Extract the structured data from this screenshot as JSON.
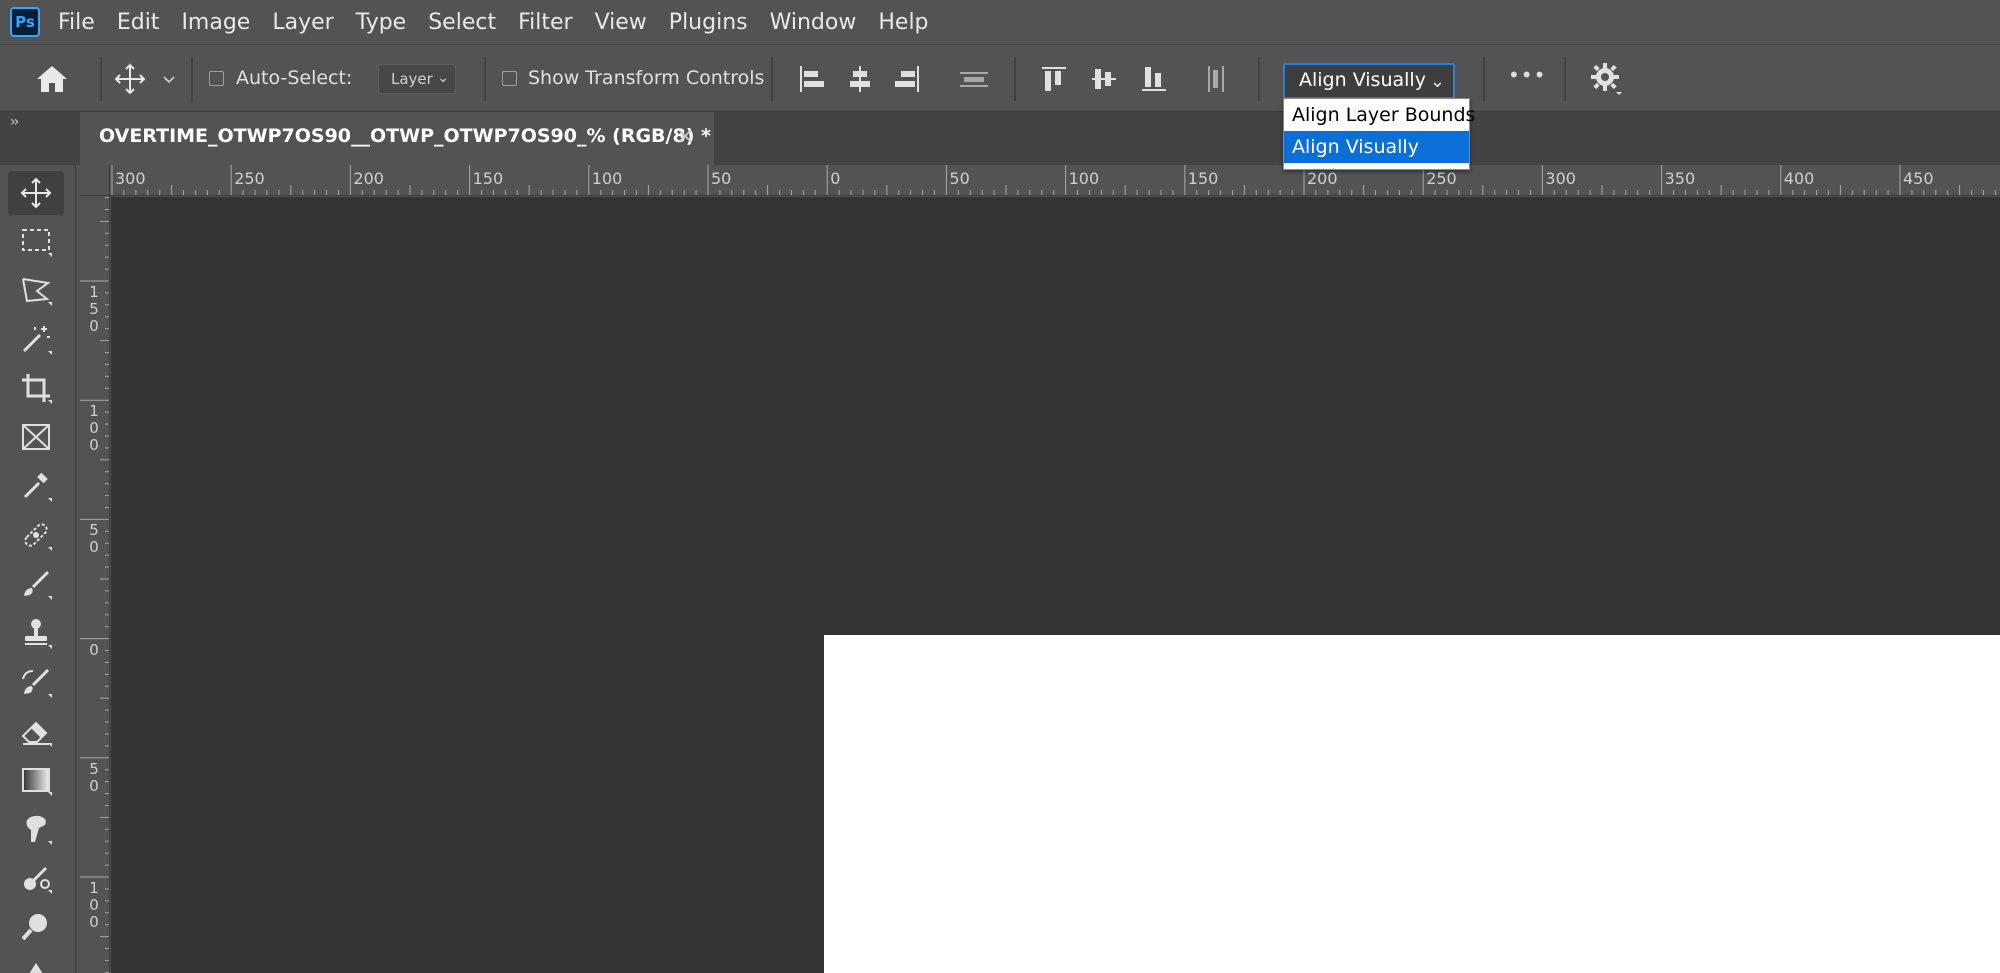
{
  "app": {
    "logo": "Ps"
  },
  "menu": [
    "File",
    "Edit",
    "Image",
    "Layer",
    "Type",
    "Select",
    "Filter",
    "View",
    "Plugins",
    "Window",
    "Help"
  ],
  "options": {
    "auto_select_label": "Auto-Select:",
    "auto_select_checked": false,
    "layer_select_value": "Layer",
    "show_transform_label": "Show Transform Controls",
    "show_transform_checked": false,
    "align_mode_value": "Align Visually",
    "more_label": "•••"
  },
  "align_dropdown": {
    "options": [
      "Align Layer Bounds",
      "Align Visually"
    ],
    "selected": "Align Visually"
  },
  "collapse_label": "››",
  "document_tab": {
    "title": "OVERTIME_OTWP7OS90__OTWP_OTWP7OS90_% (RGB/8) *",
    "close": "×"
  },
  "ruler_h_labels": [
    "300",
    "250",
    "200",
    "150",
    "100",
    "50",
    "0",
    "50",
    "100",
    "150",
    "200",
    "250",
    "300",
    "350",
    "400",
    "450"
  ],
  "ruler_v_labels": [
    "150",
    "100",
    "50",
    "0",
    "50",
    "100"
  ],
  "tools": [
    "move-tool",
    "marquee-tool",
    "lasso-tool",
    "magic-wand-tool",
    "crop-tool",
    "frame-tool",
    "eyedropper-tool",
    "healing-brush-tool",
    "brush-tool",
    "clone-stamp-tool",
    "history-brush-tool",
    "eraser-tool",
    "gradient-tool",
    "smudge-tool",
    "dodge-tool",
    "zoom-tool",
    "pen-tool"
  ],
  "colors": {
    "accent": "#0b6fd8",
    "chrome": "#535353",
    "canvas": "#333333",
    "document": "#ffffff"
  }
}
